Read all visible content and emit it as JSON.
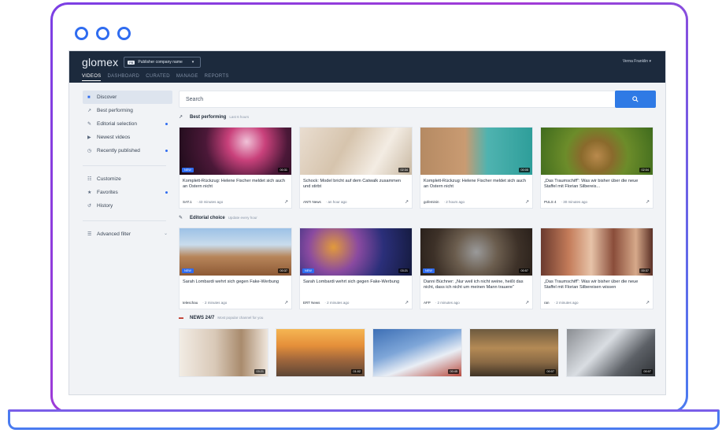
{
  "app": {
    "brand": "glomex",
    "publisher": {
      "badge": "PB",
      "label": "Publisher company name"
    },
    "user": "Verna Franklin",
    "tabs": [
      "VIDEOS",
      "DASHBOARD",
      "CURATED",
      "MANAGE",
      "REPORTS"
    ]
  },
  "sidebar": {
    "items": [
      {
        "label": "Discover",
        "icon": "discover-icon"
      },
      {
        "label": "Best performing",
        "icon": "trend-icon"
      },
      {
        "label": "Editorial selection",
        "icon": "pencil-icon"
      },
      {
        "label": "Newest videos",
        "icon": "play-icon"
      },
      {
        "label": "Recently published",
        "icon": "clock-icon"
      }
    ],
    "items2": [
      {
        "label": "Customize",
        "icon": "sliders-icon"
      },
      {
        "label": "Favorites",
        "icon": "star-icon"
      },
      {
        "label": "History",
        "icon": "history-icon"
      }
    ],
    "advanced": "Advanced filter"
  },
  "search": {
    "placeholder": "Search"
  },
  "sections": [
    {
      "title": "Best performing",
      "subtitle": "Last 6 hours",
      "cards": [
        {
          "title": "Komplett-Rückzug: Helene Fischer meldet sich auch an Ostern nicht",
          "source": "SAT.1",
          "time": "· 43 minutes ago",
          "badge": "NEW",
          "duration": "00:31"
        },
        {
          "title": "Schock: Model bricht auf dem Catwalk zusammen und stirbt",
          "source": "ANTI News",
          "time": "· an hour ago",
          "badge": "",
          "duration": "02:34"
        },
        {
          "title": "Komplett-Rückzug: Helene Fischer meldet sich auch an Ostern nicht",
          "source": "gofeminin",
          "time": "· 2 hours ago",
          "badge": "",
          "duration": "00:05"
        },
        {
          "title": "„Das Traumschiff“: Was wir bisher über die neue Staffel mit Florian Silbereis...",
          "source": "PULS 4",
          "time": "· 30 minutes ago",
          "badge": "",
          "duration": "02:04"
        }
      ]
    },
    {
      "title": "Editorial choice",
      "subtitle": "Update every hour",
      "cards": [
        {
          "title": "Sarah Lombardi wehrt sich gegen Fake-Werbung",
          "source": "teleschau",
          "time": "· 2 minutes ago",
          "badge": "NEW",
          "duration": "00:37"
        },
        {
          "title": "Sarah Lombardi wehrt sich gegen Fake-Werbung",
          "source": "ERT News",
          "time": "· 2 minutes ago",
          "badge": "NEW",
          "duration": "03:21"
        },
        {
          "title": "Danni Büchner: „Nur weil ich nicht weine, heißt das nicht, dass ich nicht um meinen Mann trauere“",
          "source": "AFP",
          "time": "· 2 minutes ago",
          "badge": "NEW",
          "duration": "00:57"
        },
        {
          "title": "„Das Traumschiff“: Was wir bisher über die neue Staffel mit Florian Silbereisen wissen",
          "source": "ran",
          "time": "· 2 minutes ago",
          "badge": "",
          "duration": "00:37"
        }
      ]
    },
    {
      "title": "NEWS 24/7",
      "subtitle": "Most popular channel for you",
      "cards": [
        {
          "duration": "03:21"
        },
        {
          "duration": "01:02"
        },
        {
          "duration": "00:45"
        },
        {
          "duration": "00:07"
        },
        {
          "duration": "00:07"
        }
      ]
    }
  ],
  "colors": {
    "accent": "#2f6cf0",
    "topbar": "#1c2a3d"
  }
}
